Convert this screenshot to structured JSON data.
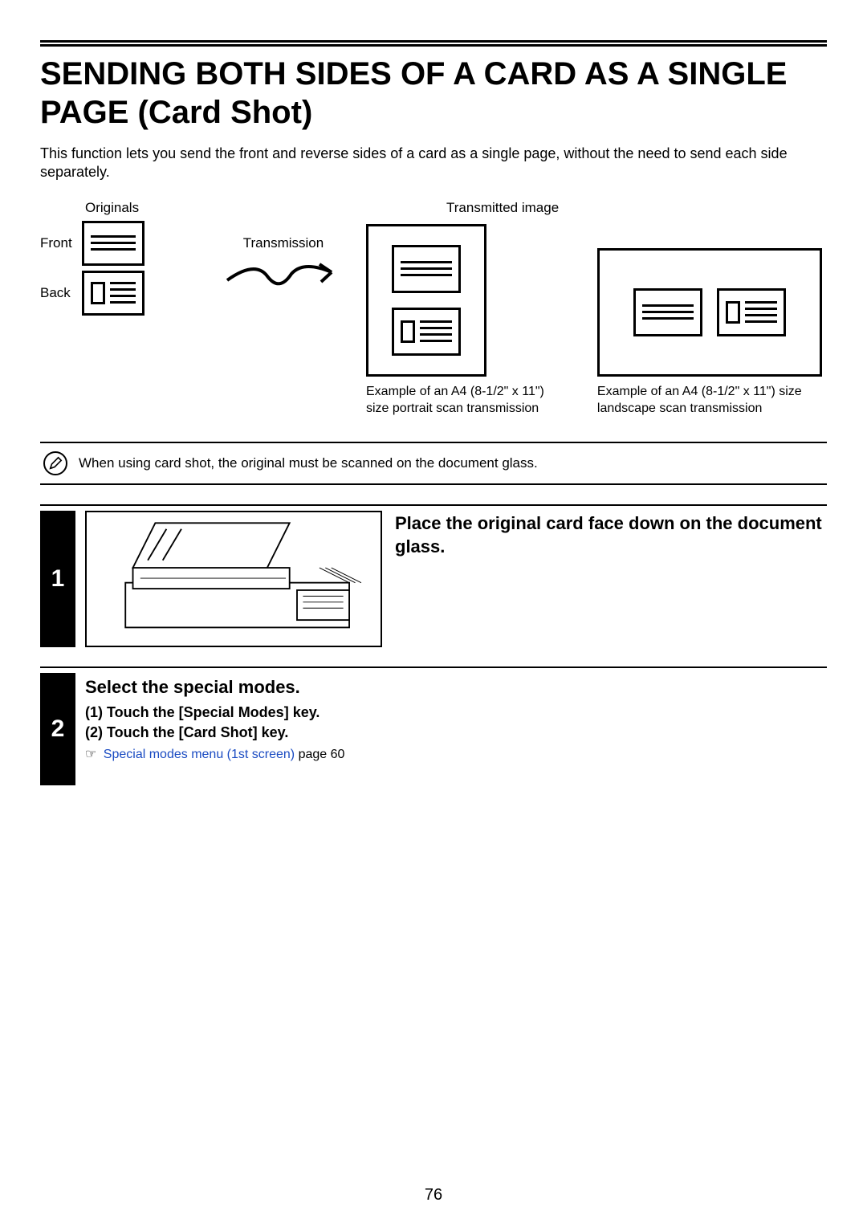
{
  "title": "SENDING BOTH SIDES OF A CARD AS A SINGLE PAGE (Card Shot)",
  "intro": "This function lets you send the front and reverse sides of a card as a single page, without the need to send each side separately.",
  "diagram": {
    "originals_label": "Originals",
    "front_label": "Front",
    "back_label": "Back",
    "transmission_label": "Transmission",
    "transmitted_label": "Transmitted image",
    "portrait_caption": "Example of an A4 (8-1/2\" x 11\") size portrait scan transmission",
    "landscape_caption": "Example of an A4 (8-1/2\" x 11\") size landscape scan transmission"
  },
  "note": "When using card shot, the original must be scanned on the document glass.",
  "steps": {
    "s1": {
      "num": "1",
      "heading": "Place the original card face down on the document glass."
    },
    "s2": {
      "num": "2",
      "heading": "Select the special modes.",
      "item1": "(1)  Touch the [Special Modes] key.",
      "item2": "(2)  Touch the [Card Shot] key.",
      "link_text": "Special modes menu (1st screen)",
      "link_page": " page 60"
    }
  },
  "page_number": "76"
}
